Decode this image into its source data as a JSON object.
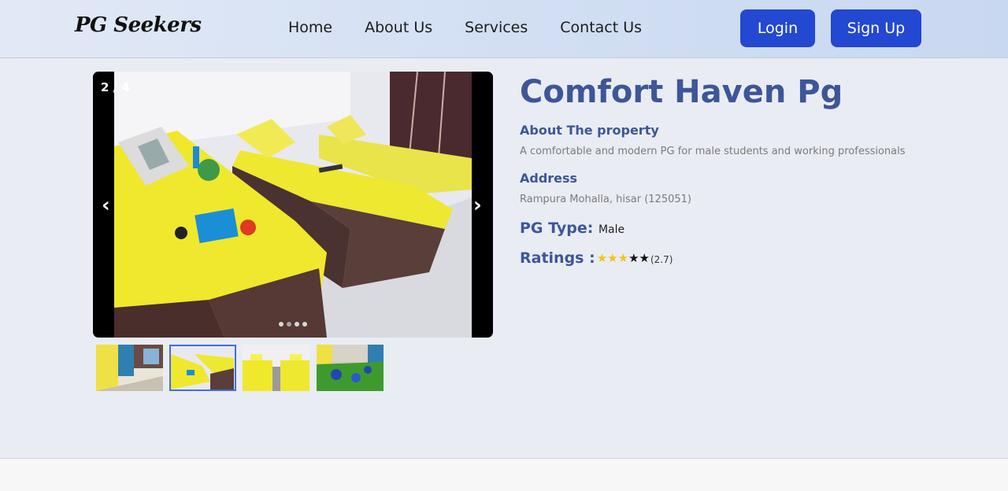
{
  "brand": "PG Seekers",
  "nav": [
    "Home",
    "About Us",
    "Services",
    "Contact Us"
  ],
  "auth": {
    "login": "Login",
    "signup": "Sign Up"
  },
  "carousel": {
    "counter": "2 / 4",
    "prev": "‹",
    "next": "›",
    "current_index": 2,
    "total": 4
  },
  "property": {
    "name": "Comfort Haven Pg",
    "about_label": "About The property",
    "about_text": "A comfortable and modern PG for male students and working professionals",
    "address_label": "Address",
    "address_text": "Rampura Mohalla, hisar (125051)",
    "type_label": "PG Type:",
    "type_value": "Male",
    "ratings_label": "Ratings :",
    "rating_value": 2.7,
    "rating_text": "(2.7)",
    "rating_max": 5
  },
  "colors": {
    "accent": "#2348d1",
    "title": "#3d5699",
    "star": "#f4c515"
  },
  "icons": [
    "chevron-left-icon",
    "chevron-right-icon",
    "star-icon"
  ]
}
